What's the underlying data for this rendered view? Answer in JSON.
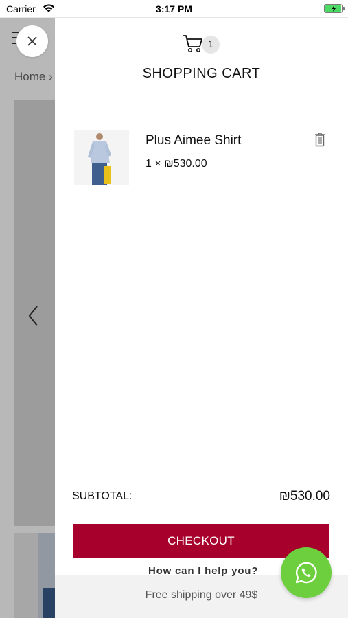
{
  "status_bar": {
    "carrier": "Carrier",
    "time": "3:17 PM"
  },
  "background": {
    "breadcrumb": "Home ›"
  },
  "cart": {
    "count": "1",
    "title": "SHOPPING CART",
    "items": [
      {
        "name": "Plus Aimee Shirt",
        "price_line": "1 × ₪530.00"
      }
    ],
    "subtotal_label": "SUBTOTAL:",
    "subtotal_value": "₪530.00",
    "checkout_label": "CHECKOUT"
  },
  "footer": {
    "help_text": "How can I help you?",
    "shipping_text": "Free shipping over 49$"
  },
  "colors": {
    "accent": "#a8002c",
    "whatsapp": "#6ecf3e",
    "battery": "#4cd964"
  }
}
